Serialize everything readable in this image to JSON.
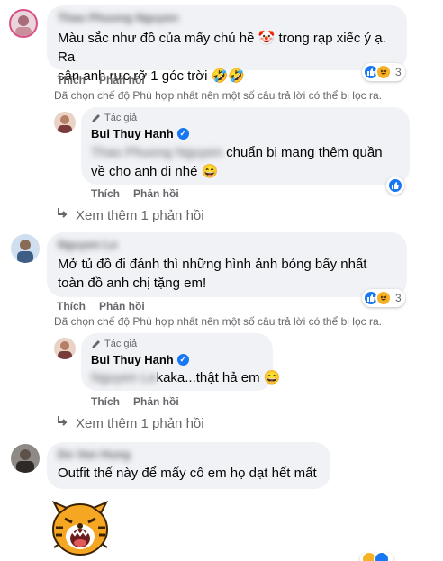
{
  "comments": [
    {
      "author": "Thao Phuong Nguyen",
      "text_line1": "Màu sắc như đồ của mấy chú hề 🤡 trong rạp xiếc ý ạ. Ra",
      "text_line2": "sân anh rực rỡ 1 góc trời 🤣🤣",
      "like": "Thích",
      "reply": "Phản hồi",
      "reaction_count": "3",
      "filter_note": "Đã chọn chế độ Phù hợp nhất nên một số câu trả lời có thể bị lọc ra.",
      "author_reply": {
        "tag": "Tác giả",
        "name": "Bui Thuy Hanh",
        "mention": "Thao Phuong Nguyen",
        "text_line1": "chuẩn bị mang thêm quần",
        "text_line2": "về cho anh đi nhé 😄",
        "like": "Thích",
        "reply": "Phản hồi"
      },
      "more_replies": "Xem thêm 1 phản hồi"
    },
    {
      "author": "Nguyen Le",
      "text_line1": "Mở tủ đồ đi đánh thì những hình ảnh bóng bẩy nhất",
      "text_line2": "toàn đồ anh chị tặng em!",
      "like": "Thích",
      "reply": "Phản hồi",
      "reaction_count": "3",
      "filter_note": "Đã chọn chế độ Phù hợp nhất nên một số câu trả lời có thể bị lọc ra.",
      "author_reply": {
        "tag": "Tác giả",
        "name": "Bui Thuy Hanh",
        "mention": "Nguyen Le",
        "text_line1": "kaka...thật hả em 😄",
        "like": "Thích",
        "reply": "Phản hồi"
      },
      "more_replies": "Xem thêm 1 phản hồi"
    },
    {
      "author": "Do Van Hung",
      "text_line1": "Outfit thế này để mấy cô em họ dạt hết mất"
    }
  ],
  "colors": {
    "bubble": "#f0f2f5",
    "secondary_text": "#65676b",
    "like_blue": "#1877f2",
    "haha_yellow": "#f7b125"
  },
  "icons": [
    "like-reaction-icon",
    "haha-reaction-icon",
    "pencil-icon",
    "verified-badge-icon",
    "reply-arrow-icon",
    "tiger-sticker"
  ]
}
